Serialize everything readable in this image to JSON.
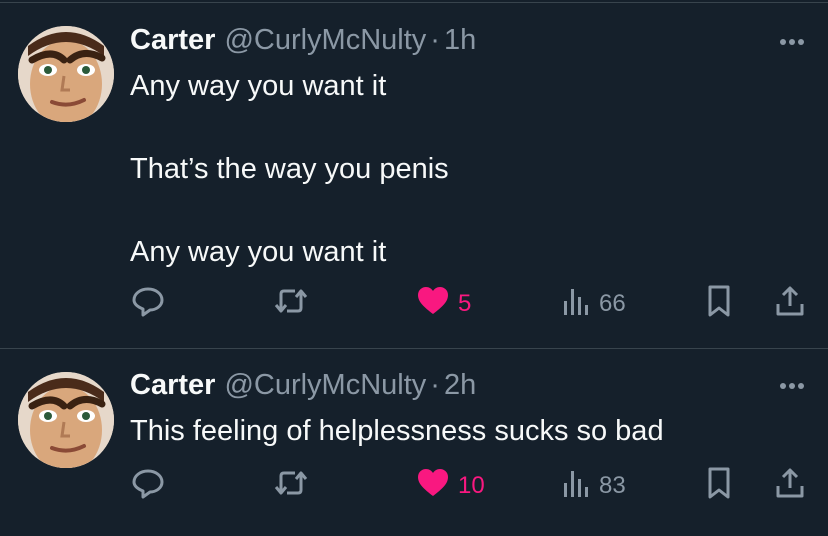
{
  "tweets": [
    {
      "author_name": "Carter",
      "handle": "@CurlyMcNulty",
      "separator": "·",
      "time": "1h",
      "lines": [
        "Any way you want it",
        "",
        "That’s the way you penis",
        "",
        "Any way you want it"
      ],
      "likes": "5",
      "views": "66",
      "liked": true
    },
    {
      "author_name": "Carter",
      "handle": "@CurlyMcNulty",
      "separator": "·",
      "time": "2h",
      "lines": [
        "This feeling of helplessness sucks so bad"
      ],
      "likes": "10",
      "views": "83",
      "liked": true
    }
  ],
  "icons": {
    "more": "more-icon",
    "reply": "reply-icon",
    "retweet": "retweet-icon",
    "like": "heart-icon",
    "views": "views-icon",
    "bookmark": "bookmark-icon",
    "share": "share-icon"
  },
  "colors": {
    "background": "#15202b",
    "text": "#f7f9f9",
    "secondary": "#8b98a5",
    "like": "#f91880",
    "divider": "#38444d"
  }
}
